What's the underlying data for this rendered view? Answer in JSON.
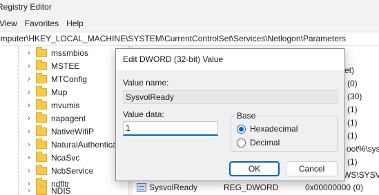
{
  "window": {
    "title": "Registry Editor"
  },
  "menubar": {
    "items": [
      "View",
      "Favorites",
      "Help"
    ]
  },
  "address": {
    "path": "omputer\\HKEY_LOCAL_MACHINE\\SYSTEM\\CurrentControlSet\\Services\\Netlogon\\Parameters"
  },
  "tree": {
    "items": [
      "mssmbios",
      "MSTEE",
      "MTConfig",
      "Mup",
      "mvumis",
      "napagent",
      "NativeWifiP",
      "NaturalAuthentica",
      "NcaSvc",
      "NcbService",
      "ndfltr",
      "NDIS"
    ],
    "chevron": "›"
  },
  "values_panel": {
    "fragments": [
      "et)",
      "(0)",
      "(30)",
      "(1)",
      "(1)",
      "(1)",
      "oot%\\syste",
      "(1)",
      "WS\\SYSVO"
    ],
    "row": {
      "name": "SysvolReady",
      "type": "REG_DWORD",
      "data": "0x00000000 (0)"
    }
  },
  "dialog": {
    "title": "Edit DWORD (32-bit) Value",
    "value_name_label": "Value name:",
    "value_name": "SysvolReady",
    "value_data_label": "Value data:",
    "value_data": "1",
    "base_label": "Base",
    "hex_label": "Hexadecimal",
    "dec_label": "Decimal",
    "selected_base": "Hexadecimal",
    "ok_label": "OK",
    "cancel_label": "Cancel",
    "accent_color": "#0067c0"
  }
}
